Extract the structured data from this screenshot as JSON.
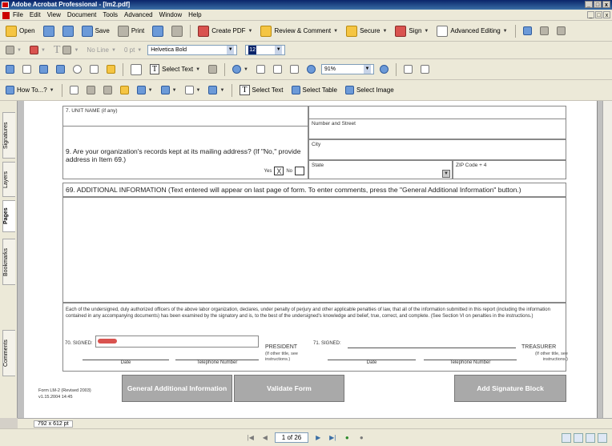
{
  "window": {
    "title": "Adobe Acrobat Professional - [lm2.pdf]",
    "controls": [
      "_",
      "□",
      "x"
    ]
  },
  "menu": [
    "File",
    "Edit",
    "View",
    "Document",
    "Tools",
    "Advanced",
    "Window",
    "Help"
  ],
  "toolbar1": {
    "open": "Open",
    "save": "Save",
    "print": "Print",
    "create_pdf": "Create PDF",
    "review": "Review & Comment",
    "secure": "Secure",
    "sign": "Sign",
    "advanced_editing": "Advanced Editing"
  },
  "toolbar2": {
    "line_style": "No Line",
    "line_weight": "0 pt",
    "font": "Helvetica Bold",
    "font_size": "12"
  },
  "toolbar3": {
    "select_text": "Select Text",
    "zoom": "91%"
  },
  "toolbar4": {
    "how_to": "How To...?",
    "select_text": "Select Text",
    "select_table": "Select Table",
    "select_image": "Select Image"
  },
  "sidebar_tabs": [
    "Signatures",
    "Layers",
    "Pages",
    "Bookmarks",
    "Comments"
  ],
  "form": {
    "unit_name": "7. UNIT NAME (if any)",
    "number_street": "Number and Street",
    "city": "City",
    "state": "State",
    "zip": "ZIP Code + 4",
    "q9": "9. Are your organization's records kept at its mailing address? (If \"No,\" provide address in Item 69.)",
    "yes": "Yes",
    "yes_mark": "X",
    "no": "No",
    "item69": "69. ADDITIONAL INFORMATION (Text entered will appear on last page of form. To enter comments, press the \"General Additional Information\" button.)",
    "declaration": "Each of the undersigned, duly authorized officers of the above labor organization, declares, under penalty of perjury and other applicable penalties of law, that all of the information submitted in this report (including the information contained in any accompanying documents) has been examined by the signatory and is, to the best of the undersigned's knowledge and belief, true, correct, and complete. (See Section VI on penalties in the instructions.)",
    "signed70": "70. SIGNED:",
    "president": "PRESIDENT",
    "other_title_1": "(If other title, see instructions.)",
    "signed71": "71. SIGNED:",
    "treasurer": "TREASURER",
    "other_title_2": "(If other title, see instructions.)",
    "date": "Date",
    "telephone": "Telephone Number",
    "form_id": "Form LM-2 (Revised 2003)",
    "version": "v1.15.2004 14:45",
    "btn_general": "General Additional Information",
    "btn_validate": "Validate Form",
    "btn_signature": "Add Signature Block"
  },
  "status": {
    "page_size": "792 x 612 pt",
    "page_indicator": "1 of 26"
  }
}
